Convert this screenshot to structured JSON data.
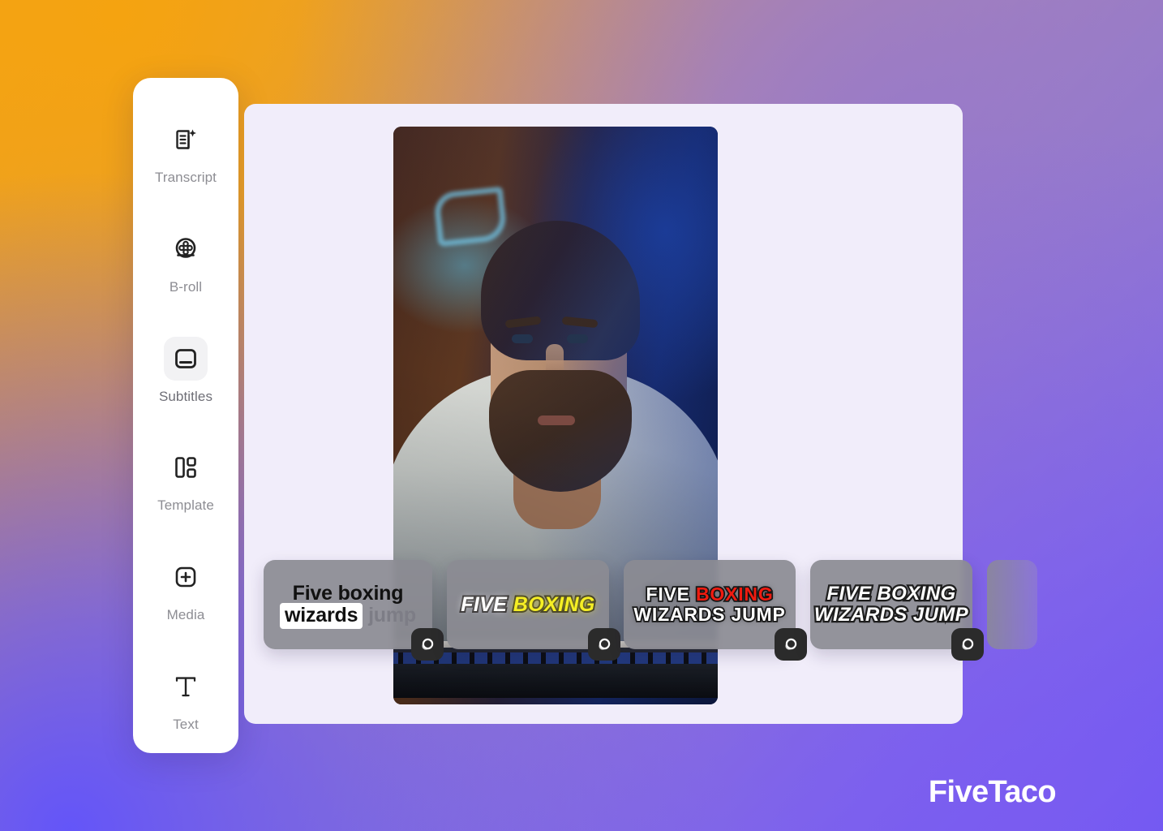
{
  "brand": {
    "name": "FiveTaco"
  },
  "sidebar": {
    "items": [
      {
        "label": "Transcript",
        "icon": "transcript-sparkle-icon",
        "active": false
      },
      {
        "label": "B-roll",
        "icon": "film-reel-icon",
        "active": false
      },
      {
        "label": "Subtitles",
        "icon": "subtitles-icon",
        "active": true
      },
      {
        "label": "Template",
        "icon": "template-layout-icon",
        "active": false
      },
      {
        "label": "Media",
        "icon": "plus-square-icon",
        "active": false
      },
      {
        "label": "Text",
        "icon": "text-t-icon",
        "active": false
      }
    ]
  },
  "preview": {
    "label": "video-preview",
    "aspect": "9:16"
  },
  "carousel": {
    "badge_icon": "coin-stack-icon",
    "styles": [
      {
        "id": "style-plain-highlight",
        "line1": "Five boxing",
        "line2_highlight": "wizards",
        "line2_rest": "jump",
        "colors": {
          "text": "#111111",
          "highlight_bg": "#ffffff",
          "dim": "#7d7d86"
        }
      },
      {
        "id": "style-yellow-glow",
        "word1": "FIVE",
        "word2": "BOXING",
        "colors": {
          "word1": "#ffffff",
          "word2": "#f6ef24",
          "stroke": "#2e2b2b"
        }
      },
      {
        "id": "style-red-accent",
        "line1_word1": "FIVE",
        "line1_word2": "BOXING",
        "line2": "WIZARDS JUMP",
        "colors": {
          "white": "#ffffff",
          "accent": "#f01b10",
          "stroke": "#1a1a1a"
        }
      },
      {
        "id": "style-italic-outline",
        "line1": "FIVE BOXING",
        "line2": "WIZARDS JUMP",
        "colors": {
          "text": "#ffffff",
          "stroke": "#1d1d1d"
        }
      },
      {
        "id": "style-next-partial",
        "line1": "",
        "line2": ""
      }
    ]
  },
  "theme": {
    "panel_bg": "#f1edfa",
    "sidebar_bg": "#ffffff",
    "card_bg": "rgba(139,139,146,0.92)",
    "gradient_start": "#f2a417",
    "gradient_end": "#6454f7"
  }
}
